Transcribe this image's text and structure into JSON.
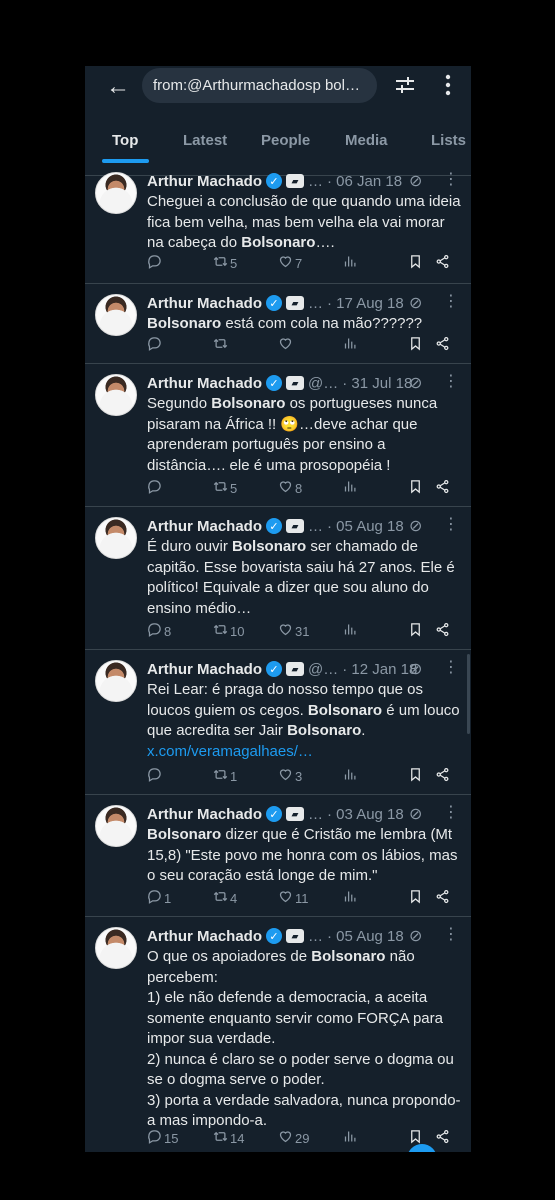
{
  "header": {
    "back_glyph": "←",
    "search_text": "from:@Arthurmachadosp bol…"
  },
  "tabs": [
    {
      "label": "Top",
      "active": true
    },
    {
      "label": "Latest",
      "active": false
    },
    {
      "label": "People",
      "active": false
    },
    {
      "label": "Media",
      "active": false
    },
    {
      "label": "Lists",
      "active": false
    }
  ],
  "tweets": [
    {
      "name": "Arthur Machado",
      "handle": "…",
      "date": "· 06 Jan 18",
      "segments": [
        {
          "t": "Cheguei a conclusão de que quando uma ideia fica bem velha, mas bem velha ela vai morar na cabeça do "
        },
        {
          "t": "Bolsonaro",
          "b": true
        },
        {
          "t": "…."
        }
      ],
      "reply": "",
      "retweets": "5",
      "likes": "7"
    },
    {
      "name": "Arthur Machado",
      "handle": "…",
      "date": "· 17 Aug 18",
      "segments": [
        {
          "t": "Bolsonaro",
          "b": true
        },
        {
          "t": " está com cola na mão??????"
        }
      ],
      "reply": "",
      "retweets": "",
      "likes": ""
    },
    {
      "name": "Arthur Machado",
      "handle": "@…",
      "date": "· 31 Jul 18",
      "segments": [
        {
          "t": "Segundo "
        },
        {
          "t": "Bolsonaro",
          "b": true
        },
        {
          "t": " os portugueses nunca pisaram na África !! 🙄…deve achar que aprenderam português por ensino a distância…. ele é uma prosopopéia !"
        }
      ],
      "reply": "",
      "retweets": "5",
      "likes": "8"
    },
    {
      "name": "Arthur Machado",
      "handle": "…",
      "date": "· 05 Aug 18",
      "segments": [
        {
          "t": "É duro ouvir "
        },
        {
          "t": "Bolsonaro",
          "b": true
        },
        {
          "t": " ser chamado de capitão. Esse bovarista saiu há 27 anos. Ele é político! Equivale a dizer que sou aluno do ensino médio…"
        }
      ],
      "reply": "8",
      "retweets": "10",
      "likes": "31"
    },
    {
      "name": "Arthur Machado",
      "handle": "@…",
      "date": "· 12 Jan 18",
      "segments": [
        {
          "t": "Rei Lear: é praga do nosso tempo que os loucos guiem os cegos. "
        },
        {
          "t": "Bolsonaro",
          "b": true
        },
        {
          "t": " é um louco que acredita ser Jair "
        },
        {
          "t": "Bolsonaro",
          "b": true
        },
        {
          "t": ".\n"
        },
        {
          "t": "x.com/veramagalhaes/…",
          "link": true
        }
      ],
      "reply": "",
      "retweets": "1",
      "likes": "3"
    },
    {
      "name": "Arthur Machado",
      "handle": "…",
      "date": "· 03 Aug 18",
      "segments": [
        {
          "t": "Bolsonaro",
          "b": true
        },
        {
          "t": " dizer que é Cristão me lembra (Mt 15,8) \"Este povo me honra com os lábios, mas o seu coração está longe de mim.\""
        }
      ],
      "reply": "1",
      "retweets": "4",
      "likes": "11"
    },
    {
      "name": "Arthur Machado",
      "handle": "…",
      "date": "· 05 Aug 18",
      "segments": [
        {
          "t": "O que os apoiadores de "
        },
        {
          "t": "Bolsonaro",
          "b": true
        },
        {
          "t": " não percebem:\n1) ele não defende a democracia, a aceita somente enquanto servir como FORÇA para impor sua verdade.\n2) nunca é claro se o poder serve o dogma ou se o dogma serve o poder.\n3) porta a verdade salvadora, nunca propondo-a mas impondo-a."
        }
      ],
      "reply": "15",
      "retweets": "14",
      "likes": "29"
    }
  ],
  "colors": {
    "background": "#15202b",
    "accent": "#1d9bf0",
    "muted": "#8b98a5",
    "border": "#38444d"
  }
}
